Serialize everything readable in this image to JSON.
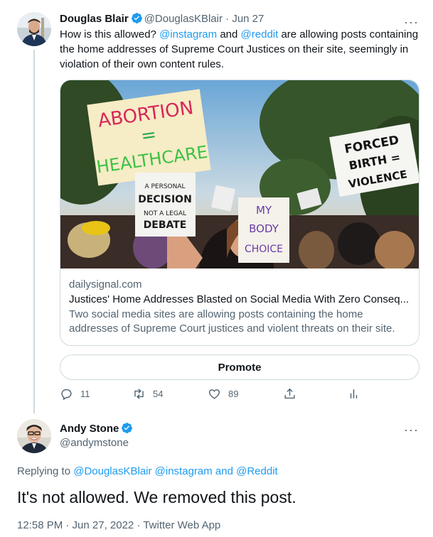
{
  "tweet1": {
    "author_name": "Douglas Blair",
    "handle": "@DouglasKBlair",
    "separator": "·",
    "date": "Jun 27",
    "text_before": "How is this allowed? ",
    "mention1": "@instagram",
    "text_mid": " and ",
    "mention2": "@reddit",
    "text_after": " are allowing posts containing the home addresses of Supreme Court Justices on their site, seemingly in violation of their own content rules.",
    "card": {
      "domain": "dailysignal.com",
      "title": "Justices' Home Addresses Blasted on Social Media With Zero Conseq...",
      "description": "Two social media sites are allowing posts containing the home addresses of Supreme Court justices and violent threats on their site.",
      "image_signs": {
        "sign1_line1": "ABORTION",
        "sign1_line2": "=",
        "sign1_line3": "HEALTHCARE",
        "sign2_line1": "FORCED",
        "sign2_line2": "BIRTH =",
        "sign2_line3": "VIOLENCE",
        "sign3_line1": "MY",
        "sign3_line2": "BODY",
        "sign3_line3": "CHOICE",
        "sign4_line1": "A PERSONAL",
        "sign4_line2": "DECISION",
        "sign4_line3": "NOT A LEGAL",
        "sign4_line4": "DEBATE"
      }
    },
    "promote_label": "Promote",
    "actions": {
      "reply_count": "11",
      "retweet_count": "54",
      "like_count": "89"
    },
    "more_label": "···"
  },
  "tweet2": {
    "author_name": "Andy Stone",
    "handle": "@andymstone",
    "replying_prefix": "Replying to ",
    "replying_to": "@DouglasKBlair @instagram and @Reddit",
    "text": "It's not allowed. We removed this post.",
    "meta": "12:58 PM · Jun 27, 2022 · Twitter Web App",
    "more_label": "···"
  },
  "colors": {
    "accent": "#1d9bf0",
    "secondary_text": "#536471",
    "border": "#cfd9de"
  },
  "icons": [
    "verified-badge-icon",
    "reply-icon",
    "retweet-icon",
    "like-icon",
    "share-icon",
    "analytics-icon",
    "more-icon"
  ]
}
